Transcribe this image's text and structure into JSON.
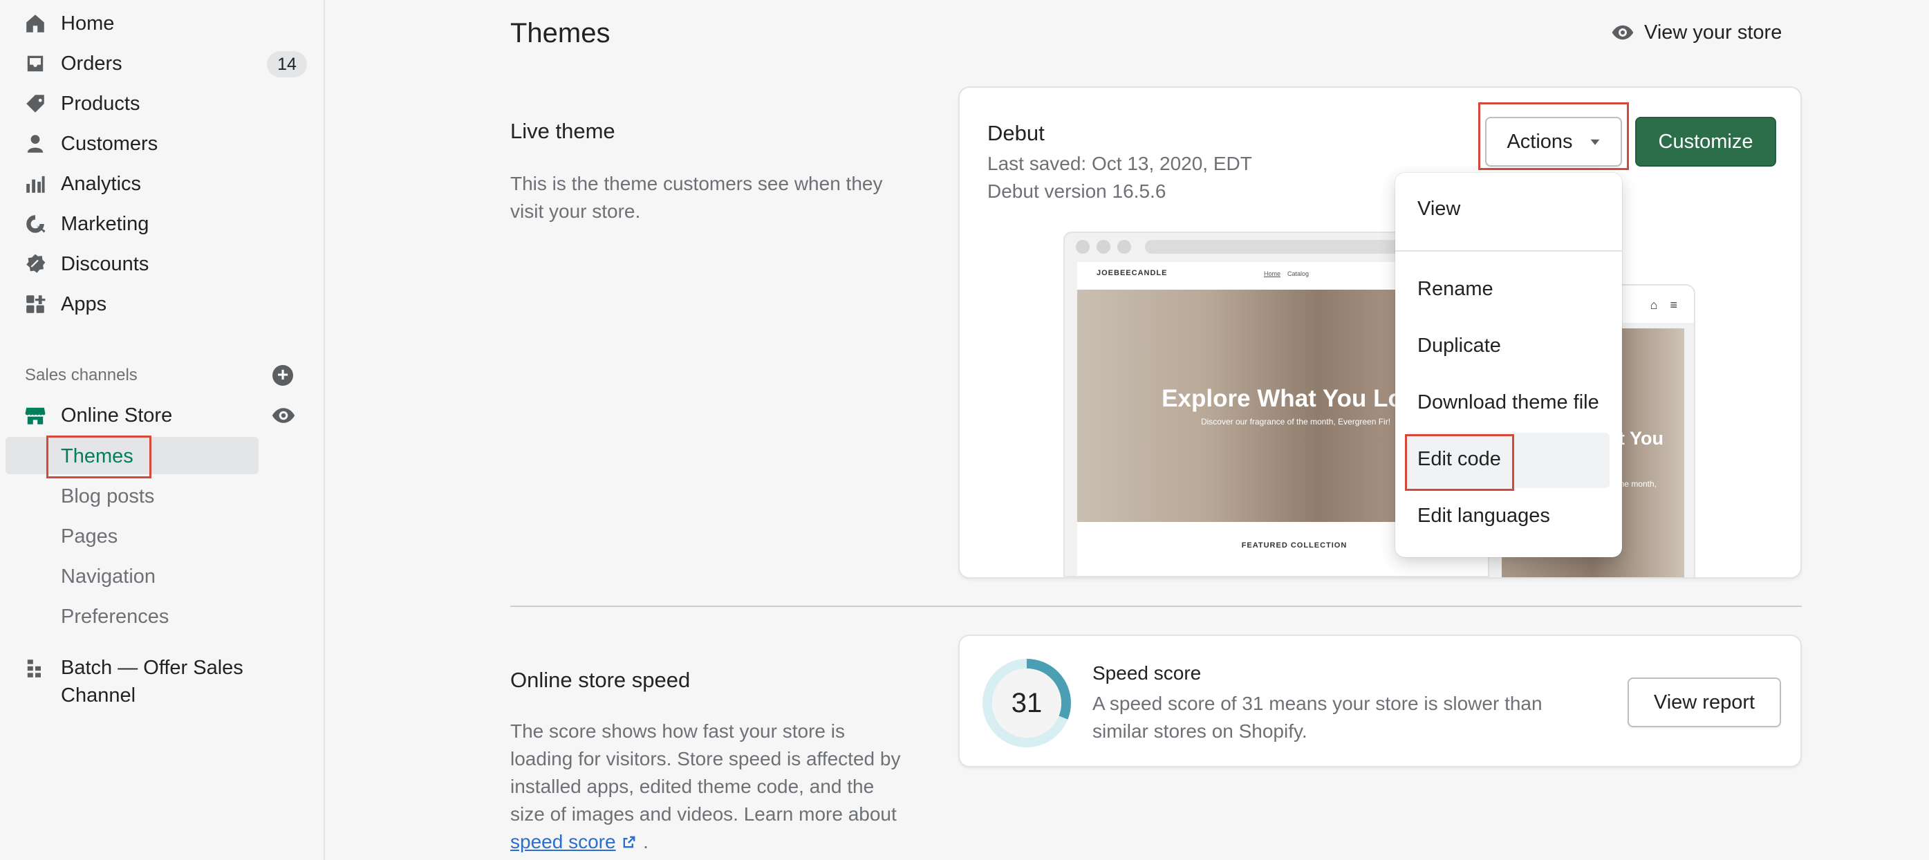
{
  "sidebar": {
    "nav": [
      {
        "label": "Home",
        "icon": "home-icon"
      },
      {
        "label": "Orders",
        "icon": "orders-icon",
        "badge": "14"
      },
      {
        "label": "Products",
        "icon": "tag-icon"
      },
      {
        "label": "Customers",
        "icon": "person-icon"
      },
      {
        "label": "Analytics",
        "icon": "analytics-icon"
      },
      {
        "label": "Marketing",
        "icon": "marketing-icon"
      },
      {
        "label": "Discounts",
        "icon": "discount-icon"
      },
      {
        "label": "Apps",
        "icon": "apps-icon"
      }
    ],
    "sales_channels_heading": "Sales channels",
    "online_store": "Online Store",
    "sub_items": [
      "Themes",
      "Blog posts",
      "Pages",
      "Navigation",
      "Preferences"
    ],
    "batch_app": "Batch — Offer Sales Channel"
  },
  "header": {
    "title": "Themes",
    "view_store": "View your store"
  },
  "live_theme": {
    "heading": "Live theme",
    "description": "This is the theme customers see when they visit your store.",
    "theme_name": "Debut",
    "last_saved": "Last saved: Oct 13, 2020, EDT",
    "version": "Debut version 16.5.6",
    "actions_label": "Actions",
    "customize_label": "Customize",
    "preview": {
      "logo": "JOEBEECANDLE",
      "nav": [
        "Home",
        "Catalog"
      ],
      "hero_title": "Explore What You Love",
      "hero_sub": "Discover our fragrance of the month, Evergreen Fir!",
      "featured": "FEATURED COLLECTION",
      "mobile_title": "What You",
      "mobile_sub": "the month,"
    }
  },
  "actions_menu": [
    "View",
    "Rename",
    "Duplicate",
    "Download theme file",
    "Edit code",
    "Edit languages"
  ],
  "speed": {
    "heading": "Online store speed",
    "description": "The score shows how fast your store is loading for visitors. Store speed is affected by installed apps, edited theme code, and the size of images and videos. Learn more about",
    "link_label": "speed score",
    "trailing": ".",
    "score": 31,
    "score_title": "Speed score",
    "score_desc": "A speed score of 31 means your store is slower than similar stores on Shopify.",
    "view_report": "View report"
  },
  "colors": {
    "accent_green": "#2c6e49",
    "highlight_red": "#d44a3a",
    "active_text": "#007f5f",
    "gauge_blue": "#4a9fb5"
  }
}
